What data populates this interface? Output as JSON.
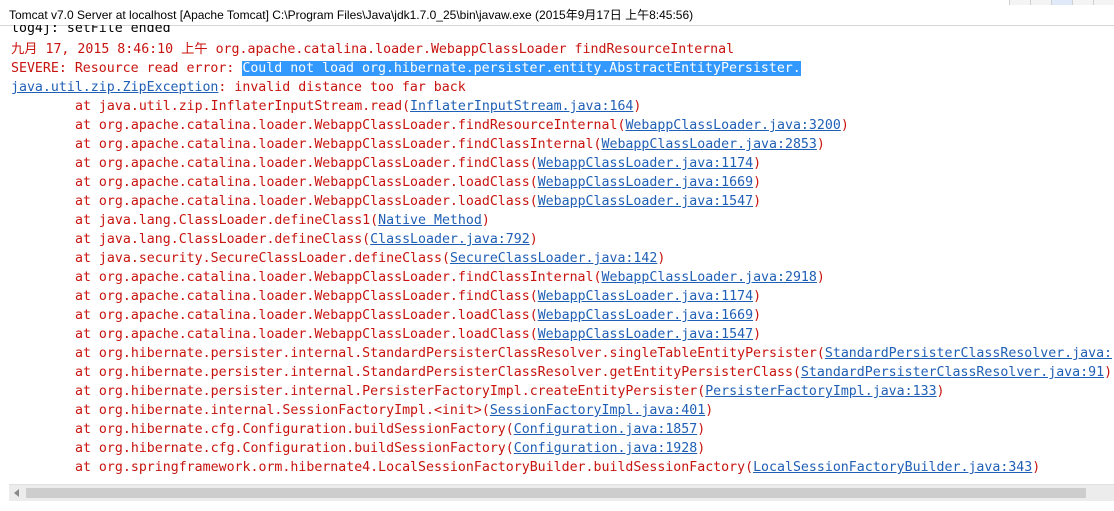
{
  "window": {
    "title": "Tomcat v7.0 Server at localhost [Apache Tomcat] C:\\Program Files\\Java\\jdk1.7.0_25\\bin\\javaw.exe (2015年9月17日 上午8:45:56)"
  },
  "console": {
    "line_partial": "log4j: setFile ended",
    "line_date": "九月 17, 2015 8:46:10 上午 org.apache.catalina.loader.WebappClassLoader findResourceInternal",
    "severe_prefix": "SEVERE: Resource read error: ",
    "severe_selected": "Could not load org.hibernate.persister.entity.AbstractEntityPersister.",
    "exception_link": "java.util.zip.ZipException",
    "exception_msg": ": invalid distance too far back",
    "frames": [
      {
        "text": "at java.util.zip.InflaterInputStream.read(",
        "link": "InflaterInputStream.java:164",
        "end": ")"
      },
      {
        "text": "at org.apache.catalina.loader.WebappClassLoader.findResourceInternal(",
        "link": "WebappClassLoader.java:3200",
        "end": ")"
      },
      {
        "text": "at org.apache.catalina.loader.WebappClassLoader.findClassInternal(",
        "link": "WebappClassLoader.java:2853",
        "end": ")"
      },
      {
        "text": "at org.apache.catalina.loader.WebappClassLoader.findClass(",
        "link": "WebappClassLoader.java:1174",
        "end": ")"
      },
      {
        "text": "at org.apache.catalina.loader.WebappClassLoader.loadClass(",
        "link": "WebappClassLoader.java:1669",
        "end": ")"
      },
      {
        "text": "at org.apache.catalina.loader.WebappClassLoader.loadClass(",
        "link": "WebappClassLoader.java:1547",
        "end": ")"
      },
      {
        "text": "at java.lang.ClassLoader.defineClass1(",
        "link": "Native Method",
        "end": ")"
      },
      {
        "text": "at java.lang.ClassLoader.defineClass(",
        "link": "ClassLoader.java:792",
        "end": ")"
      },
      {
        "text": "at java.security.SecureClassLoader.defineClass(",
        "link": "SecureClassLoader.java:142",
        "end": ")"
      },
      {
        "text": "at org.apache.catalina.loader.WebappClassLoader.findClassInternal(",
        "link": "WebappClassLoader.java:2918",
        "end": ")"
      },
      {
        "text": "at org.apache.catalina.loader.WebappClassLoader.findClass(",
        "link": "WebappClassLoader.java:1174",
        "end": ")"
      },
      {
        "text": "at org.apache.catalina.loader.WebappClassLoader.loadClass(",
        "link": "WebappClassLoader.java:1669",
        "end": ")"
      },
      {
        "text": "at org.apache.catalina.loader.WebappClassLoader.loadClass(",
        "link": "WebappClassLoader.java:1547",
        "end": ")"
      },
      {
        "text": "at org.hibernate.persister.internal.StandardPersisterClassResolver.singleTableEntityPersister(",
        "link": "StandardPersisterClassResolver.java:",
        "end": ""
      },
      {
        "text": "at org.hibernate.persister.internal.StandardPersisterClassResolver.getEntityPersisterClass(",
        "link": "StandardPersisterClassResolver.java:91",
        "end": ")"
      },
      {
        "text": "at org.hibernate.persister.internal.PersisterFactoryImpl.createEntityPersister(",
        "link": "PersisterFactoryImpl.java:133",
        "end": ")"
      },
      {
        "text": "at org.hibernate.internal.SessionFactoryImpl.<init>(",
        "link": "SessionFactoryImpl.java:401",
        "end": ")"
      },
      {
        "text": "at org.hibernate.cfg.Configuration.buildSessionFactory(",
        "link": "Configuration.java:1857",
        "end": ")"
      },
      {
        "text": "at org.hibernate.cfg.Configuration.buildSessionFactory(",
        "link": "Configuration.java:1928",
        "end": ")"
      },
      {
        "text": "at org.springframework.orm.hibernate4.LocalSessionFactoryBuilder.buildSessionFactory(",
        "link": "LocalSessionFactoryBuilder.java:343",
        "end": ")"
      }
    ]
  },
  "colors": {
    "error_text": "#c8130e",
    "link": "#1f5fb5",
    "selection": "#3399ff"
  }
}
